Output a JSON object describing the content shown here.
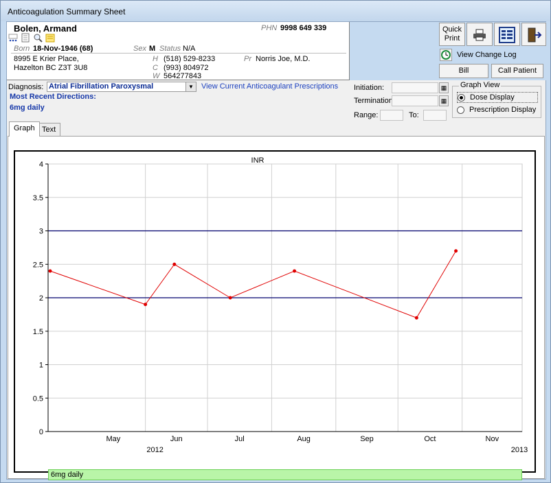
{
  "window": {
    "title": "Anticoagulation Summary Sheet"
  },
  "patient": {
    "name": "Bolen, Armand",
    "phn_label": "PHN",
    "phn": "9998 649 339",
    "born_label": "Born",
    "born": "18-Nov-1946 (68)",
    "sex_label": "Sex",
    "sex": "M",
    "status_label": "Status",
    "status": "N/A",
    "address1": "8995 E Krier Place,",
    "address2": "Hazelton BC  Z3T 3U8",
    "h_label": "H",
    "h_phone": "(518) 529-8233",
    "c_label": "C",
    "c_phone": "(993) 804972",
    "w_label": "W",
    "w_phone": "564277843",
    "pr_label": "Pr",
    "provider": "Norris Joe, M.D."
  },
  "actions": {
    "quick_print_line1": "Quick",
    "quick_print_line2": "Print",
    "view_change_log": "View Change Log",
    "bill": "Bill",
    "call_patient": "Call Patient",
    "icons": [
      "printer-icon",
      "summary-sheet-icon",
      "exit-door-icon",
      "clock-icon"
    ]
  },
  "diagnosis": {
    "label": "Diagnosis:",
    "value": "Atrial Fibrillation Paroxysmal",
    "link": "View Current Anticoagulant Prescriptions",
    "mrd_label": "Most Recent Directions:",
    "mrd_value": "6mg daily"
  },
  "fields": {
    "initiation_label": "Initiation:",
    "termination_label": "Termination",
    "range_label": "Range:",
    "to_label": "To:"
  },
  "graph_view": {
    "legend": "Graph View",
    "dose_display": "Dose Display",
    "prescription_display": "Prescription Display",
    "selected": "Dose Display"
  },
  "tabs": [
    {
      "label": "Graph",
      "active": true
    },
    {
      "label": "Text",
      "active": false
    }
  ],
  "chart_data": {
    "type": "line",
    "title": "INR",
    "ylim": [
      0,
      4
    ],
    "yticks": [
      "0",
      "0.5",
      "1",
      "1.5",
      "2",
      "2.5",
      "3",
      "3.5",
      "4"
    ],
    "xlim": [
      "2012-04-15",
      "2012-11-30"
    ],
    "months": [
      {
        "label": "May",
        "date": "2012-05-01"
      },
      {
        "label": "Jun",
        "date": "2012-06-01"
      },
      {
        "label": "Jul",
        "date": "2012-07-01"
      },
      {
        "label": "Aug",
        "date": "2012-08-01"
      },
      {
        "label": "Sep",
        "date": "2012-09-01"
      },
      {
        "label": "Oct",
        "date": "2012-10-01"
      },
      {
        "label": "Nov",
        "date": "2012-11-01"
      }
    ],
    "year_labels": [
      "2012",
      "2013"
    ],
    "target_range": [
      2,
      3
    ],
    "series": [
      {
        "points": [
          {
            "x": "2012-04-16",
            "y": 2.4
          },
          {
            "x": "2012-06-01",
            "y": 1.9
          },
          {
            "x": "2012-06-15",
            "y": 2.5
          },
          {
            "x": "2012-07-12",
            "y": 2.0
          },
          {
            "x": "2012-08-12",
            "y": 2.4
          },
          {
            "x": "2012-10-10",
            "y": 1.7
          },
          {
            "x": "2012-10-29",
            "y": 2.7
          }
        ],
        "color": "#e00000"
      }
    ],
    "target_line_color": "#00006e",
    "grid": true,
    "dose_label": "6mg daily",
    "dose_bar_color": "#b9f5a8"
  }
}
